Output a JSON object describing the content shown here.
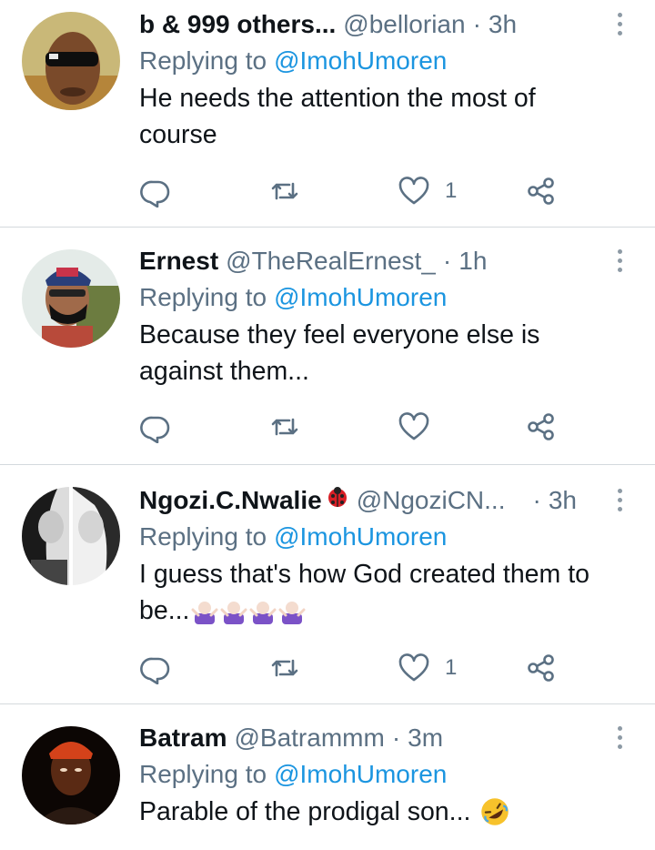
{
  "reply_prefix": "Replying to",
  "tweets": [
    {
      "name": "b & 999 others...",
      "handle": "@bellorian",
      "dot": "·",
      "time": "3h",
      "reply_to": "@ImohUmoren",
      "text": "He needs the attention the most of course",
      "like_count": "1"
    },
    {
      "name": "Ernest",
      "handle": "@TheRealErnest_",
      "dot": "·",
      "time": "1h",
      "reply_to": "@ImohUmoren",
      "text": "Because they feel everyone else is against them...",
      "like_count": ""
    },
    {
      "name": "Ngozi.C.Nwalie",
      "handle": "@NgoziCN...",
      "dot": "·",
      "time": "3h",
      "reply_to": "@ImohUmoren",
      "text": "I guess that's how God created them to be...",
      "like_count": "1"
    },
    {
      "name": "Batram",
      "handle": "@Batrammm",
      "dot": "·",
      "time": "3m",
      "reply_to": "@ImohUmoren",
      "text": "Parable of the prodigal son...",
      "like_count": ""
    }
  ],
  "icons": {
    "reply": "reply-icon",
    "retweet": "retweet-icon",
    "like": "heart-icon",
    "share": "share-icon",
    "more": "more-vertical-icon"
  },
  "colors": {
    "text": "#0f1419",
    "secondary": "#5b7083",
    "link": "#1b95e0",
    "divider": "#d4d9dd"
  }
}
